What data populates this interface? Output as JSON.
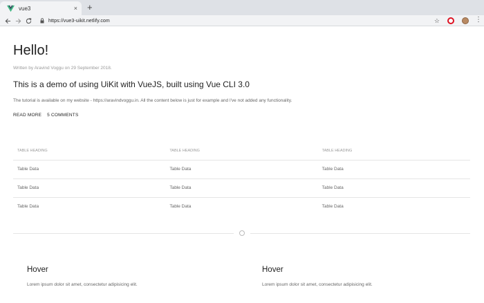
{
  "browser": {
    "tab_title": "vue3",
    "tab_close": "×",
    "new_tab": "+",
    "url": "https://vue3-uikit.netlify.com",
    "star": "☆",
    "menu": "⋮"
  },
  "article": {
    "title": "Hello!",
    "meta": "Written by Aravind Voggu on 29 September 2018.",
    "lead": "This is a demo of using UiKit with VueJS, built using Vue CLI 3.0",
    "body": "The tutorial is available on my website - https://aravindvoggu.in. All the content below is just for example and I've not added any functionality.",
    "read_more": "READ MORE",
    "comments": "5 COMMENTS"
  },
  "table": {
    "headers": [
      "TABLE HEADING",
      "TABLE HEADING",
      "TABLE HEADING"
    ],
    "rows": [
      [
        "Table Data",
        "Table Data",
        "Table Data"
      ],
      [
        "Table Data",
        "Table Data",
        "Table Data"
      ],
      [
        "Table Data",
        "Table Data",
        "Table Data"
      ]
    ]
  },
  "cards": [
    {
      "title": "Hover",
      "text": "Lorem ipsum dolor sit amet, consectetur adipisicing elit."
    },
    {
      "title": "Hover",
      "text": "Lorem ipsum dolor sit amet, consectetur adipisicing elit."
    }
  ],
  "colors": {
    "vue_green": "#41b883",
    "vue_dark": "#35495e",
    "opera_red": "#dd1122"
  }
}
